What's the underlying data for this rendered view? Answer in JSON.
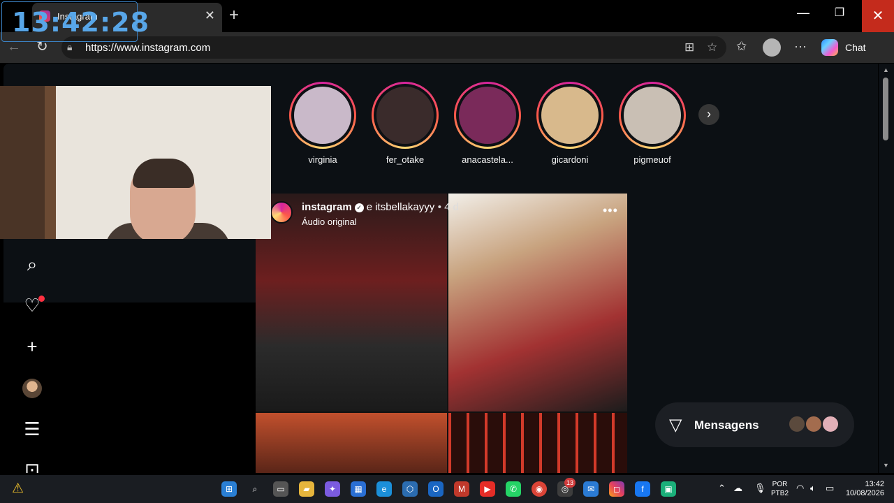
{
  "overlay": {
    "clock": "13:42:28"
  },
  "browser": {
    "tab_title": "Instagram",
    "url": "https://www.instagram.com",
    "chat_label": "Chat"
  },
  "stories": {
    "items": [
      {
        "username": "virginia",
        "color": "#c9b9c9"
      },
      {
        "username": "fer_otake",
        "color": "#3a2b2b"
      },
      {
        "username": "anacastela...",
        "color": "#7a2a5a"
      },
      {
        "username": "gicardoni",
        "color": "#d8b98c"
      },
      {
        "username": "pigmeuof",
        "color": "#c9bfb4"
      }
    ]
  },
  "post": {
    "username": "instagram",
    "verified_glyph": "✓",
    "connector": "e itsbellakayyy",
    "time": "• 4 d",
    "audio": "Áudio original"
  },
  "messages": {
    "label": "Mensagens"
  },
  "taskbar": {
    "badge_count": "13",
    "lang_primary": "POR",
    "lang_secondary": "PTB2",
    "time": "13:42",
    "date": "10/08/2026"
  }
}
